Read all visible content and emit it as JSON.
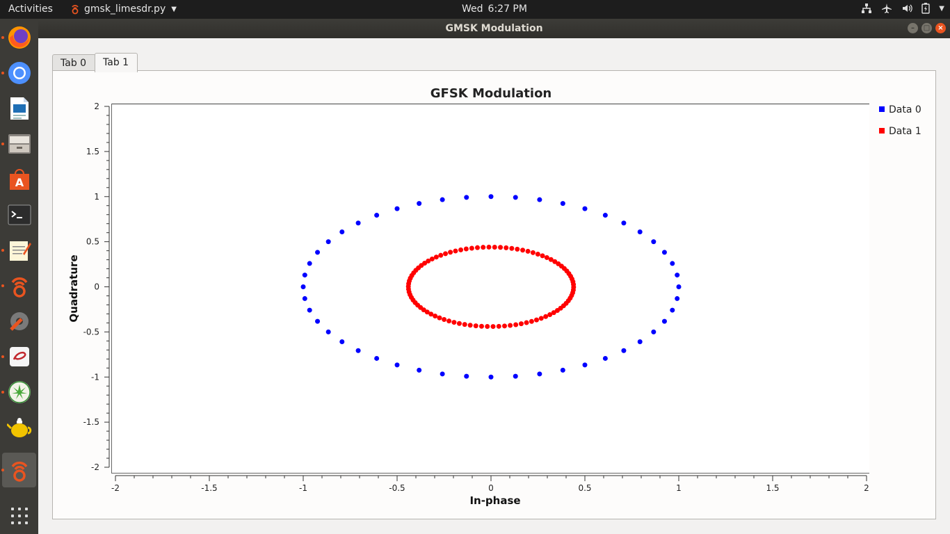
{
  "topbar": {
    "activities": "Activities",
    "app_name": "gmsk_limesdr.py",
    "day": "Wed",
    "time": "6:27 PM",
    "icons": [
      "network-icon",
      "airplane-mode-icon",
      "volume-icon",
      "battery-icon",
      "system-menu-arrow-icon"
    ]
  },
  "dock": {
    "items": [
      {
        "name": "firefox",
        "icon": "firefox-icon",
        "running": true
      },
      {
        "name": "chromium",
        "icon": "chromium-icon",
        "running": true
      },
      {
        "name": "writer",
        "icon": "libreoffice-writer-icon",
        "running": false
      },
      {
        "name": "files",
        "icon": "files-icon",
        "running": true
      },
      {
        "name": "software",
        "icon": "software-center-icon",
        "running": false
      },
      {
        "name": "terminal",
        "icon": "terminal-icon",
        "running": false
      },
      {
        "name": "text-editor",
        "icon": "text-editor-icon",
        "running": true
      },
      {
        "name": "gnuradio",
        "icon": "gnuradio-icon",
        "running": true
      },
      {
        "name": "settings",
        "icon": "settings-icon",
        "running": false
      },
      {
        "name": "app-red",
        "icon": "app-icon",
        "running": true
      },
      {
        "name": "lime-suite",
        "icon": "lime-suite-icon",
        "running": true
      },
      {
        "name": "teapot",
        "icon": "teapot-icon",
        "running": false
      },
      {
        "name": "gmsk-app",
        "icon": "gnuradio-icon",
        "running": true,
        "active": true
      }
    ],
    "show_apps_icon": "show-applications-icon"
  },
  "window": {
    "title": "GMSK Modulation",
    "tabs": [
      {
        "label": "Tab 0",
        "selected": false
      },
      {
        "label": "Tab 1",
        "selected": true
      }
    ]
  },
  "chart_data": {
    "type": "scatter",
    "title": "GFSK Modulation",
    "xlabel": "In-phase",
    "ylabel": "Quadrature",
    "xlim": [
      -2,
      2
    ],
    "ylim": [
      -2,
      2
    ],
    "xticks": [
      "-2",
      "-1.5",
      "-1",
      "-0.5",
      "0",
      "0.5",
      "1",
      "1.5",
      "2"
    ],
    "yticks": [
      "2",
      "1.5",
      "1",
      "0.5",
      "0",
      "-0.5",
      "-1",
      "-1.5",
      "-2"
    ],
    "grid": false,
    "legend_position": "right",
    "series": [
      {
        "name": "Data 0",
        "color": "#0000ff",
        "radius": 1.0,
        "points": 48
      },
      {
        "name": "Data 1",
        "color": "#ff0000",
        "radius": 0.44,
        "points": 90
      }
    ]
  },
  "colors": {
    "accent": "#e95420",
    "topbar_bg": "#1d1d1d",
    "dock_bg": "#3c3b37"
  }
}
